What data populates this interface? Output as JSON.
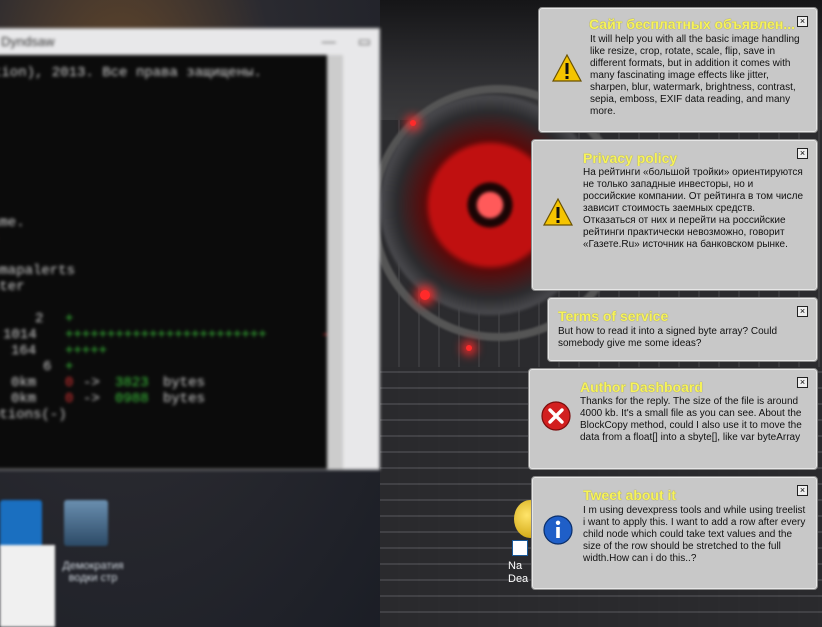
{
  "console": {
    "title": "Dyndsaw",
    "lines": [
      "tion), 2013. Все права защищены.",
      "ame.",
      "nmapalerts",
      "ster",
      "2",
      "1014",
      "164",
      "6",
      "0km",
      "0km",
      "ptions(-)"
    ]
  },
  "desktop": {
    "icon_label": "Демократия водки стр",
    "shortcut_label_line1": "Na",
    "shortcut_label_line2": "Dea"
  },
  "notifications": [
    {
      "title": "Сайт бесплатных объявлен...",
      "icon": "warning-icon",
      "body": "It will help you with all the basic image handling like resize, crop, rotate, scale, flip, save in different formats, but in addition it comes with many fascinating image effects like jitter, sharpen, blur, watermark, brightness, contrast, sepia, emboss, EXIF data reading, and many more."
    },
    {
      "title": "Privacy policy",
      "icon": "warning-icon",
      "body": "На рейтинги «большой тройки» ориентируются не только западные инвесторы, но и российские компании. От рейтинга в том числе зависит стоимость заемных средств. Отказаться от них и перейти на российские рейтинги практически невозможно, говорит «Газете.Ru» источник на банковском рынке."
    },
    {
      "title": "Terms of service",
      "icon": "",
      "body": "But how to read it into a signed byte array? Could somebody give me some ideas?"
    },
    {
      "title": "Author Dashboard",
      "icon": "error-icon",
      "body": "Thanks for the reply. The size of the file is around 4000 kb. It's a small file as you can see. About the BlockCopy method, could I also use it to move the data from a float[] into a sbyte[], like var byteArray"
    },
    {
      "title": "Tweet about it",
      "icon": "info-icon",
      "body": "I m using devexpress tools and while using treelist i want to apply this. I want to add a row after every child node which could take text values and the size of the row should be stretched to the full width.How can i do this..?"
    }
  ],
  "colors": {
    "toast_bg": "#c8c8c8",
    "toast_title": "#f7f35a",
    "close_symbol": "☒"
  }
}
